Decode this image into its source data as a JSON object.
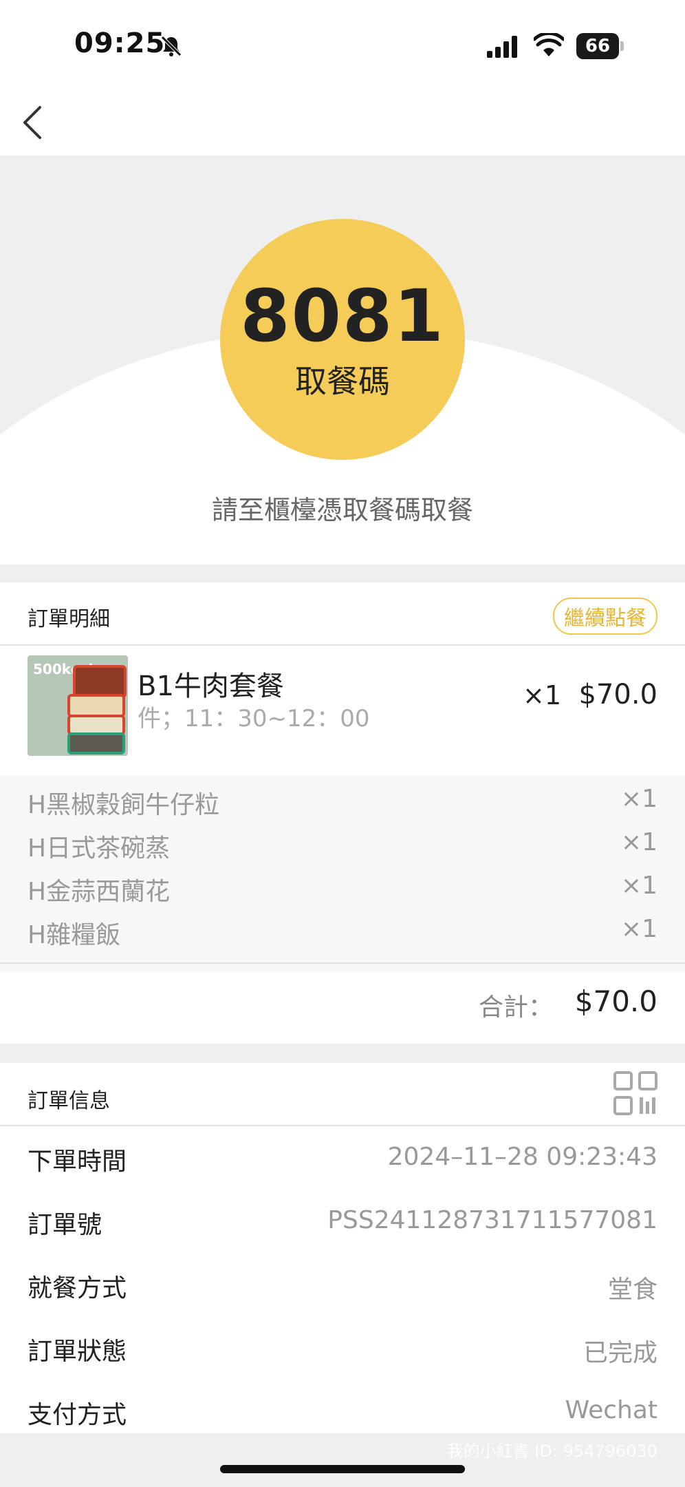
{
  "status": {
    "time": "09:25",
    "battery": "66"
  },
  "pickup": {
    "code": "8081",
    "code_label": "取餐碼",
    "hint": "請至櫃檯憑取餐碼取餐"
  },
  "order_detail": {
    "title": "訂單明細",
    "reorder_label": "繼續點餐",
    "item": {
      "thumb_text": "500kcal",
      "name": "B1牛肉套餐",
      "spec": "件；11：30~12：00",
      "qty": "×1",
      "price": "$70.0"
    },
    "sub_items": [
      {
        "name": "H黑椒穀飼牛仔粒",
        "qty": "×1"
      },
      {
        "name": "H日式茶碗蒸",
        "qty": "×1"
      },
      {
        "name": "H金蒜西蘭花",
        "qty": "×1"
      },
      {
        "name": "H雜糧飯",
        "qty": "×1"
      }
    ],
    "total_label": "合計：",
    "total_value": "$70.0"
  },
  "order_info": {
    "title": "訂單信息",
    "rows": [
      {
        "key": "下單時間",
        "value": "2024–11–28 09:23:43"
      },
      {
        "key": "訂單號",
        "value": "PSS2411287317115770​81"
      },
      {
        "key": "就餐方式",
        "value": "堂食"
      },
      {
        "key": "訂單狀態",
        "value": "已完成"
      },
      {
        "key": "支付方式",
        "value": "Wechat"
      }
    ]
  },
  "watermark": "我的小紅書 ID: 954796030",
  "colors": {
    "accent": "#f5cc57",
    "accent_text": "#e5b534"
  }
}
